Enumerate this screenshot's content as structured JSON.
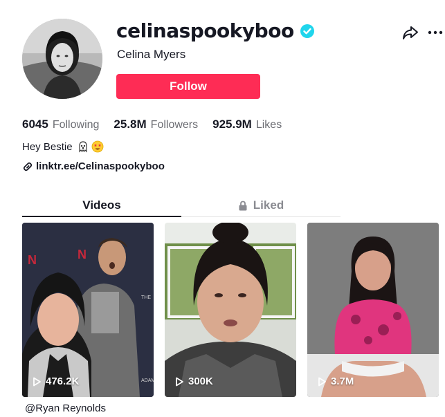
{
  "profile": {
    "username": "celinaspookyboo",
    "nickname": "Celina Myers",
    "follow_label": "Follow",
    "verified_icon": "verified-badge-icon",
    "avatar_icon": "profile-avatar"
  },
  "stats": {
    "following_count": "6045",
    "following_label": "Following",
    "followers_count": "25.8M",
    "followers_label": "Followers",
    "likes_count": "925.9M",
    "likes_label": "Likes"
  },
  "bio": {
    "text": "Hey Bestie",
    "emojis": [
      "ghost-emoji",
      "star-struck-emoji"
    ]
  },
  "link": {
    "text": "linktr.ee/Celinaspookyboo",
    "icon": "link-icon"
  },
  "tabs": [
    {
      "label": "Videos",
      "active": true
    },
    {
      "label": "Liked",
      "active": false,
      "icon": "lock-icon"
    }
  ],
  "videos": [
    {
      "views": "476.2K"
    },
    {
      "views": "300K"
    },
    {
      "views": "3.7M"
    }
  ],
  "caption": "@Ryan Reynolds",
  "colors": {
    "accent": "#fe2c55",
    "verified": "#20d5ec",
    "text": "#161823",
    "muted": "#6b6c72"
  }
}
